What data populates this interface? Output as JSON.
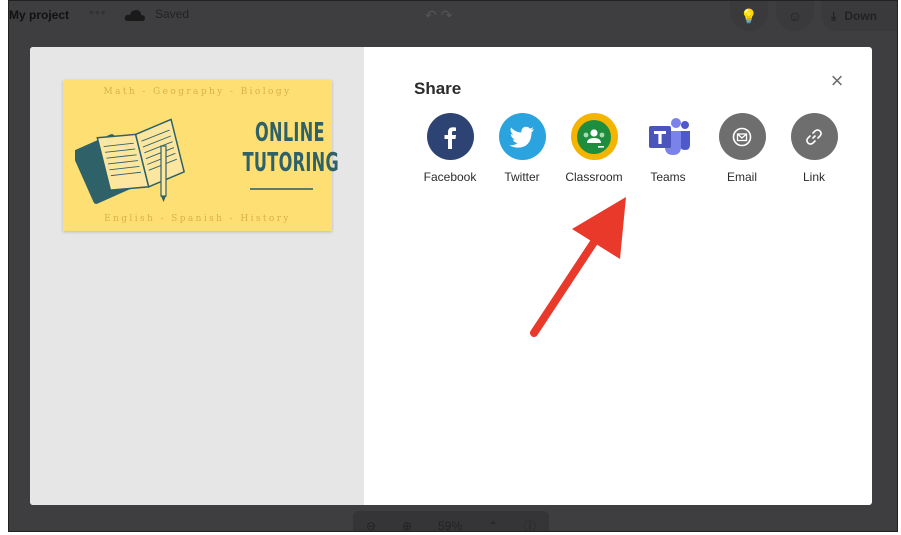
{
  "topbar": {
    "project_title": "My project",
    "more_label": "•••",
    "saved_label": "Saved",
    "undo_label": "↶ ↷",
    "download_label": "Down"
  },
  "zoom": {
    "zoom_out": "⊖",
    "zoom_in": "⊕",
    "level": "59%",
    "expand": "⌃",
    "info": "ⓘ"
  },
  "preview_card": {
    "top_line": "Math - Geography - Biology",
    "title_line1": "ONLINE",
    "title_line2": "TUTORING",
    "bottom_line": "English - Spanish - History"
  },
  "share": {
    "title": "Share",
    "close": "×",
    "options": [
      {
        "label": "Facebook",
        "icon": "facebook-icon",
        "color": "#2d4373"
      },
      {
        "label": "Twitter",
        "icon": "twitter-icon",
        "color": "#2aa3df"
      },
      {
        "label": "Classroom",
        "icon": "classroom-icon",
        "color": "#1e8e3e"
      },
      {
        "label": "Teams",
        "icon": "teams-icon",
        "color": "#5059c9"
      },
      {
        "label": "Email",
        "icon": "email-icon",
        "color": "#6e6e6e"
      },
      {
        "label": "Link",
        "icon": "link-icon",
        "color": "#6e6e6e"
      }
    ]
  },
  "colors": {
    "backdrop": "#3e3e40",
    "annotation_arrow": "#e8392b"
  }
}
